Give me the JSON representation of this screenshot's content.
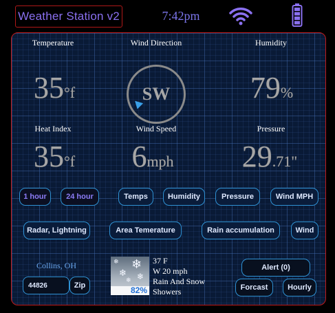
{
  "header": {
    "title": "Weather Station v2",
    "time": "7:42pm",
    "wifi_icon": "wifi-icon",
    "battery_icon": "battery-icon"
  },
  "readings": {
    "temperature": {
      "label": "Temperature",
      "value": "35",
      "unit": "°f"
    },
    "wind_direction": {
      "label": "Wind Direction",
      "value": "SW"
    },
    "humidity": {
      "label": "Humidity",
      "value": "79",
      "unit": "%"
    },
    "heat_index": {
      "label": "Heat Index",
      "value": "35",
      "unit": "°f"
    },
    "wind_speed": {
      "label": "Wind Speed",
      "value": "6",
      "unit": "mph"
    },
    "pressure": {
      "label": "Pressure",
      "value": "29",
      "unit": ".71\""
    }
  },
  "time_buttons": [
    "1 hour",
    "24 hour"
  ],
  "chart_buttons": [
    "Temps",
    "Humidity",
    "Pressure",
    "Wind MPH"
  ],
  "map_buttons": [
    "Radar, Lightning",
    "Area Temerature",
    "Rain accumulation",
    "Wind"
  ],
  "location": {
    "name": "Collins, OH",
    "zip_value": "44826",
    "zip_button": "Zip"
  },
  "forecast": {
    "precip_percent": "82%",
    "line1": "37 F",
    "line2": "W 20 mph",
    "line3": "Rain And Snow",
    "line4": "Showers",
    "image_icon": "snow-cloud-icon"
  },
  "actions": {
    "alert": "Alert (0)",
    "forecast": "Forcast",
    "hourly": "Hourly"
  },
  "colors": {
    "accent_purple": "#8a70f0",
    "panel_border": "#c21a1a",
    "button_border": "#2f92d4",
    "value_gray": "#a6a6a6"
  }
}
